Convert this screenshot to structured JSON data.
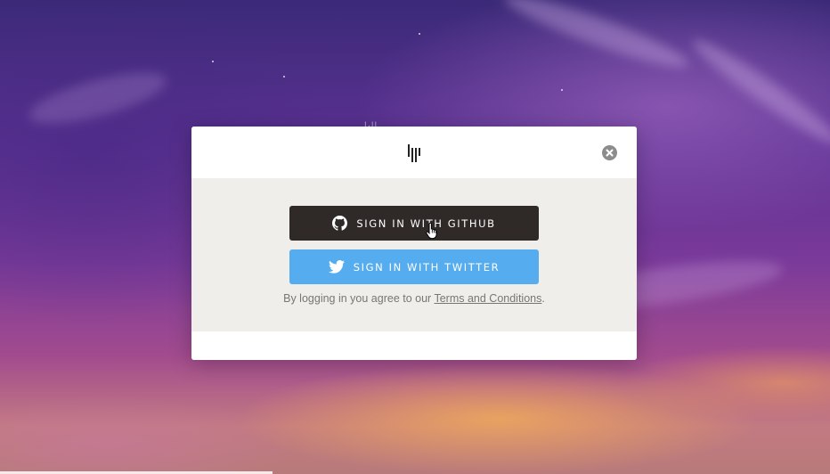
{
  "modal": {
    "github_button_label": "SIGN IN WITH GITHUB",
    "twitter_button_label": "SIGN IN WITH TWITTER",
    "terms_prefix": "By logging in you agree to our ",
    "terms_link": "Terms and Conditions",
    "terms_suffix": "."
  },
  "icons": {
    "logo": "gitter-logo-icon",
    "close": "close-icon",
    "github": "github-icon",
    "twitter": "twitter-icon",
    "cursor": "hand-pointer-cursor"
  },
  "colors": {
    "github_button": "#2f2a28",
    "twitter_button": "#55acee",
    "body_bg": "#f0eeea",
    "close_bg": "#8c8c8c"
  }
}
